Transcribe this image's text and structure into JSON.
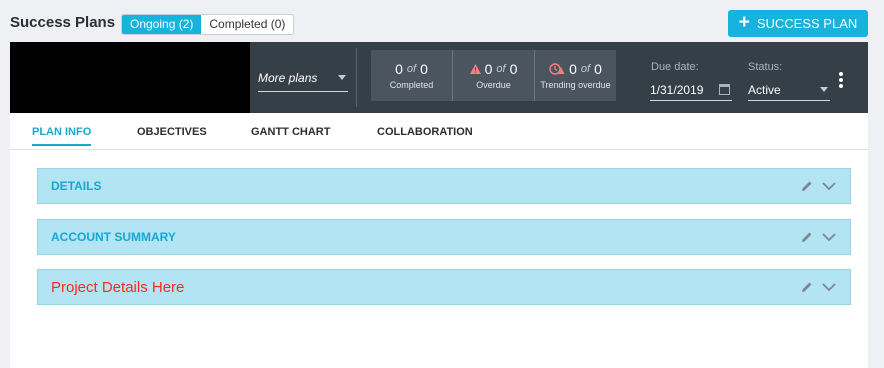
{
  "header": {
    "title": "Success Plans",
    "filters": [
      {
        "label": "Ongoing (2)",
        "active": true
      },
      {
        "label": "Completed (0)",
        "active": false
      }
    ],
    "add_button": {
      "label": "SUCCESS PLAN",
      "icon": "plus-icon"
    }
  },
  "plan": {
    "more_plans": "More plans",
    "stats": [
      {
        "value": "0",
        "of": "of",
        "total": "0",
        "label": "Completed",
        "icon": ""
      },
      {
        "value": "0",
        "of": "of",
        "total": "0",
        "label": "Overdue",
        "icon": "warning-icon"
      },
      {
        "value": "0",
        "of": "of",
        "total": "0",
        "label": "Trending overdue",
        "icon": "clock-warning-icon"
      }
    ],
    "due_date": {
      "label": "Due date:",
      "value": "1/31/2019"
    },
    "status": {
      "label": "Status:",
      "value": "Active"
    }
  },
  "tabs": [
    {
      "label": "PLAN INFO",
      "active": true
    },
    {
      "label": "OBJECTIVES",
      "active": false
    },
    {
      "label": "GANTT CHART",
      "active": false
    },
    {
      "label": "COLLABORATION",
      "active": false
    }
  ],
  "sections": [
    {
      "title": "DETAILS"
    },
    {
      "title": "ACCOUNT SUMMARY"
    },
    {
      "title": "Project Details Here"
    }
  ],
  "colors": {
    "accent": "#17b3dd",
    "header_bg": "#353f48",
    "section_bg": "#b2e4f4",
    "note_text": "#ff2a1a"
  }
}
